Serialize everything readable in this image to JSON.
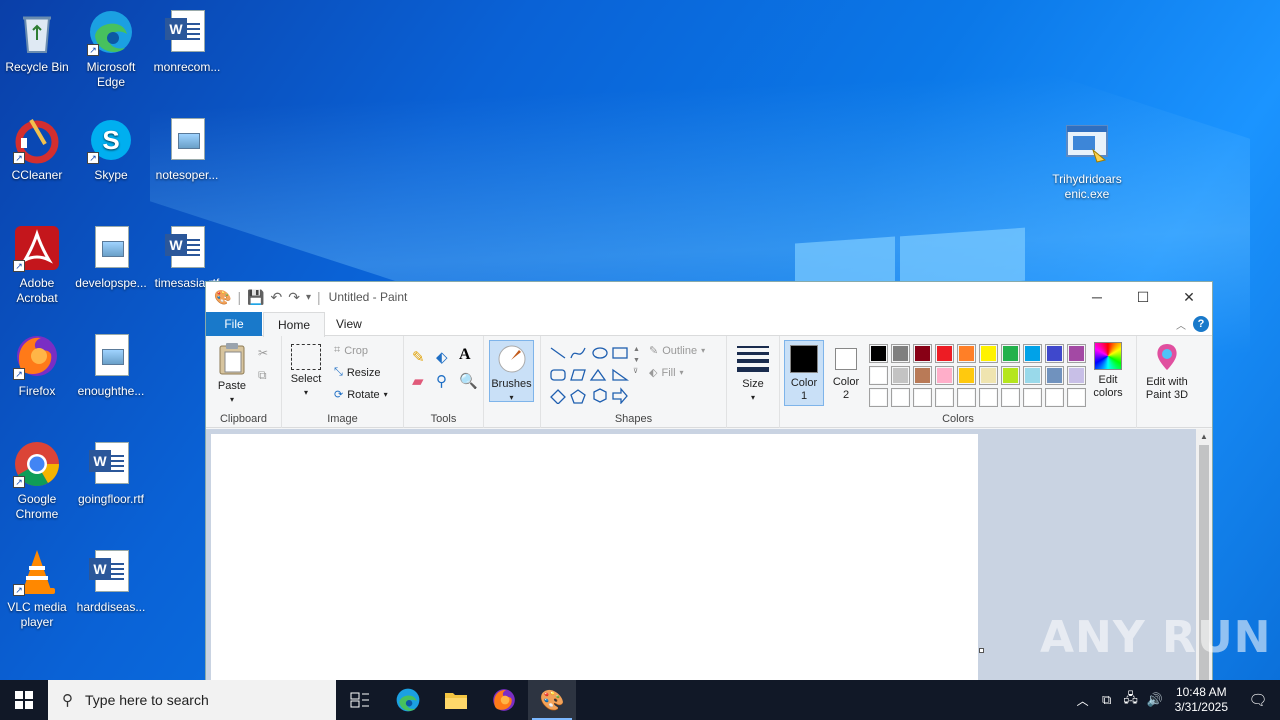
{
  "desktop": {
    "icons": [
      {
        "label": "Recycle Bin",
        "name": "recycle-bin-icon"
      },
      {
        "label": "Microsoft Edge",
        "name": "edge-icon"
      },
      {
        "label": "monrecom...",
        "name": "word-doc-icon"
      },
      {
        "label": "CCleaner",
        "name": "ccleaner-icon"
      },
      {
        "label": "Skype",
        "name": "skype-icon"
      },
      {
        "label": "notesoper...",
        "name": "image-doc-icon"
      },
      {
        "label": "Adobe Acrobat",
        "name": "acrobat-icon"
      },
      {
        "label": "developspe...",
        "name": "image-doc-icon"
      },
      {
        "label": "timesasia.rtf",
        "name": "word-doc-icon"
      },
      {
        "label": "Firefox",
        "name": "firefox-icon"
      },
      {
        "label": "enoughthe...",
        "name": "image-doc-icon"
      },
      {
        "label": "Google Chrome",
        "name": "chrome-icon"
      },
      {
        "label": "goingfloor.rtf",
        "name": "word-doc-icon"
      },
      {
        "label": "VLC media player",
        "name": "vlc-icon"
      },
      {
        "label": "harddiseas...",
        "name": "word-doc-icon"
      },
      {
        "label": "Trihydridoarsenic.exe",
        "name": "exe-icon"
      }
    ]
  },
  "paint": {
    "title": "Untitled - Paint",
    "tabs": {
      "file": "File",
      "home": "Home",
      "view": "View"
    },
    "clipboard": {
      "paste": "Paste",
      "group": "Clipboard"
    },
    "image": {
      "select": "Select",
      "crop": "Crop",
      "resize": "Resize",
      "rotate": "Rotate",
      "group": "Image"
    },
    "tools": {
      "group": "Tools"
    },
    "brushes": {
      "label": "Brushes"
    },
    "shapes": {
      "outline": "Outline",
      "fill": "Fill",
      "group": "Shapes"
    },
    "size": {
      "label": "Size"
    },
    "colors": {
      "color1": "Color 1",
      "color2": "Color 2",
      "edit_colors": "Edit colors",
      "edit_paint3d": "Edit with Paint 3D",
      "group": "Colors",
      "color1_value": "#000000",
      "color2_value": "#ffffff",
      "palette_row1": [
        "#000000",
        "#7f7f7f",
        "#880015",
        "#ed1c24",
        "#ff7f27",
        "#fff200",
        "#22b14c",
        "#00a2e8",
        "#3f48cc",
        "#a349a4"
      ],
      "palette_row2": [
        "#ffffff",
        "#c3c3c3",
        "#b97a57",
        "#ffaec9",
        "#ffc90e",
        "#efe4b0",
        "#b5e61d",
        "#99d9ea",
        "#7092be",
        "#c8bfe7"
      ],
      "palette_row3": [
        "",
        "",
        "",
        "",
        "",
        "",
        "",
        "",
        "",
        ""
      ]
    }
  },
  "taskbar": {
    "search_placeholder": "Type here to search",
    "time": "10:48 AM",
    "date": "3/31/2025"
  },
  "watermark": "ANY RUN"
}
